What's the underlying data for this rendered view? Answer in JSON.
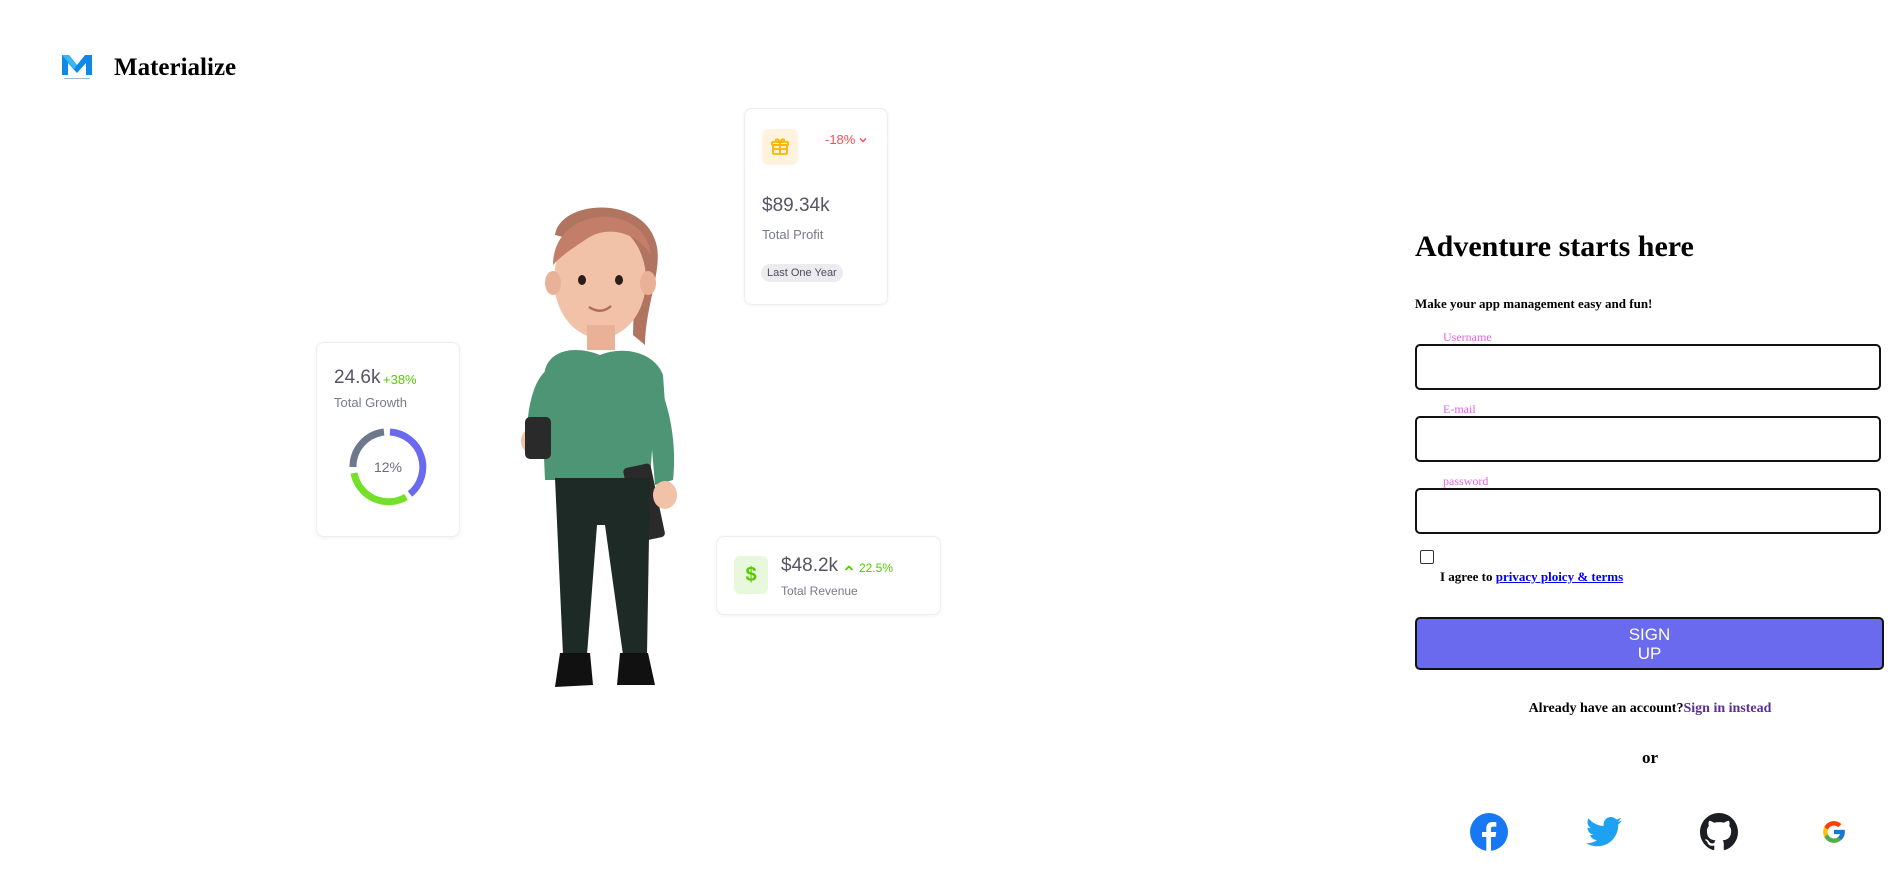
{
  "brand": {
    "name": "Materialize",
    "logo_icon": "materialize-logo-icon",
    "accent": "#0f88e8"
  },
  "stats": {
    "profit": {
      "change": "-18%",
      "value": "$89.34k",
      "label": "Total Profit",
      "chip": "Last One Year",
      "icon": "gift-icon",
      "change_color": "#ff4c51"
    },
    "growth": {
      "value": "24.6k",
      "change": "+38%",
      "label": "Total Growth",
      "donut_center": "12%",
      "change_color": "#56ca00"
    },
    "revenue": {
      "value": "$48.2k",
      "change": "22.5%",
      "label": "Total Revenue",
      "icon": "dollar-icon",
      "change_color": "#56ca00"
    }
  },
  "form": {
    "title": "Adventure starts here",
    "subtitle": "Make your app management easy and fun!",
    "username_label": "Username",
    "email_label": "E-mail",
    "password_label": "password",
    "agree_text": "I agree to ",
    "agree_link": "privacy ploicy & terms",
    "signup_label": "SIGN UP",
    "have_account": "Already have an account?",
    "sign_in_link": "Sign in instead",
    "or": "or",
    "primary_color": "#6a6aef"
  },
  "social": [
    "facebook-icon",
    "twitter-icon",
    "github-icon",
    "google-icon"
  ]
}
